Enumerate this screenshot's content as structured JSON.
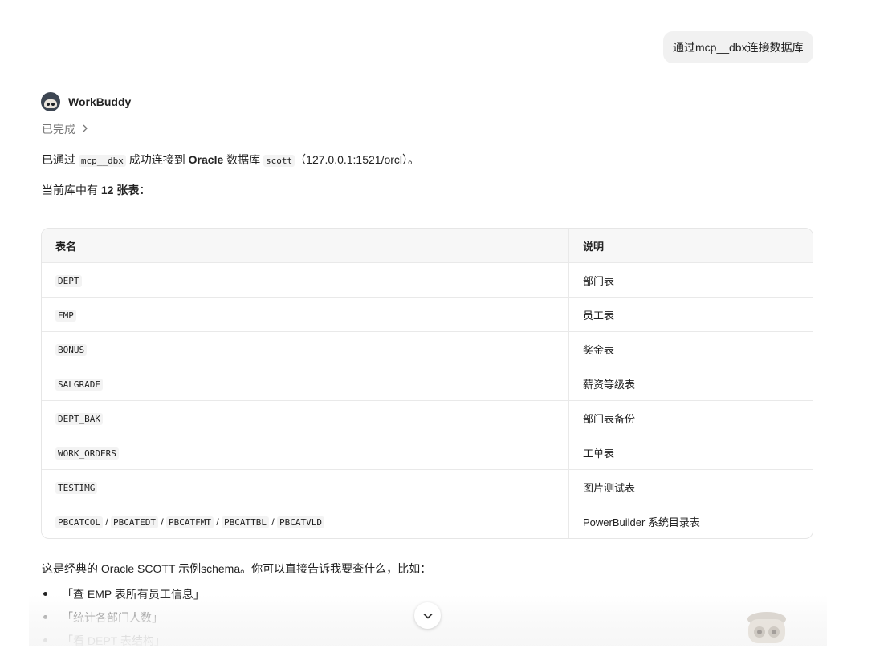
{
  "user_message": "通过mcp__dbx连接数据库",
  "bot": {
    "name": "WorkBuddy",
    "status": "已完成",
    "intro": {
      "prefix": "已通过 ",
      "tool": "mcp__dbx",
      "middle": " 成功连接到 ",
      "db_type": "Oracle",
      "db_word": " 数据库 ",
      "schema": "scott",
      "conn": "（127.0.0.1:1521/orcl）。"
    },
    "summary": {
      "prefix": "当前库中有 ",
      "count_text": "12 张表",
      "suffix": "："
    },
    "table": {
      "headers": [
        "表名",
        "说明"
      ],
      "rows": [
        {
          "name": "DEPT",
          "desc": "部门表"
        },
        {
          "name": "EMP",
          "desc": "员工表"
        },
        {
          "name": "BONUS",
          "desc": "奖金表"
        },
        {
          "name": "SALGRADE",
          "desc": "薪资等级表"
        },
        {
          "name": "DEPT_BAK",
          "desc": "部门表备份"
        },
        {
          "name": "WORK_ORDERS",
          "desc": "工单表"
        },
        {
          "name": "TESTIMG",
          "desc": "图片测试表"
        }
      ],
      "last_row": {
        "names": [
          "PBCATCOL",
          "PBCATEDT",
          "PBCATFMT",
          "PBCATTBL",
          "PBCATVLD"
        ],
        "separator": " / ",
        "desc": "PowerBuilder 系统目录表"
      }
    },
    "outro": "这是经典的 Oracle SCOTT 示例schema。你可以直接告诉我要查什么，比如：",
    "examples": [
      "「查 EMP 表所有员工信息」",
      "「统计各部门人数」",
      "「看 DEPT 表结构」"
    ]
  },
  "icons": {
    "status_chevron": "chevron-right-icon",
    "scroll_button": "chevron-down-icon"
  }
}
